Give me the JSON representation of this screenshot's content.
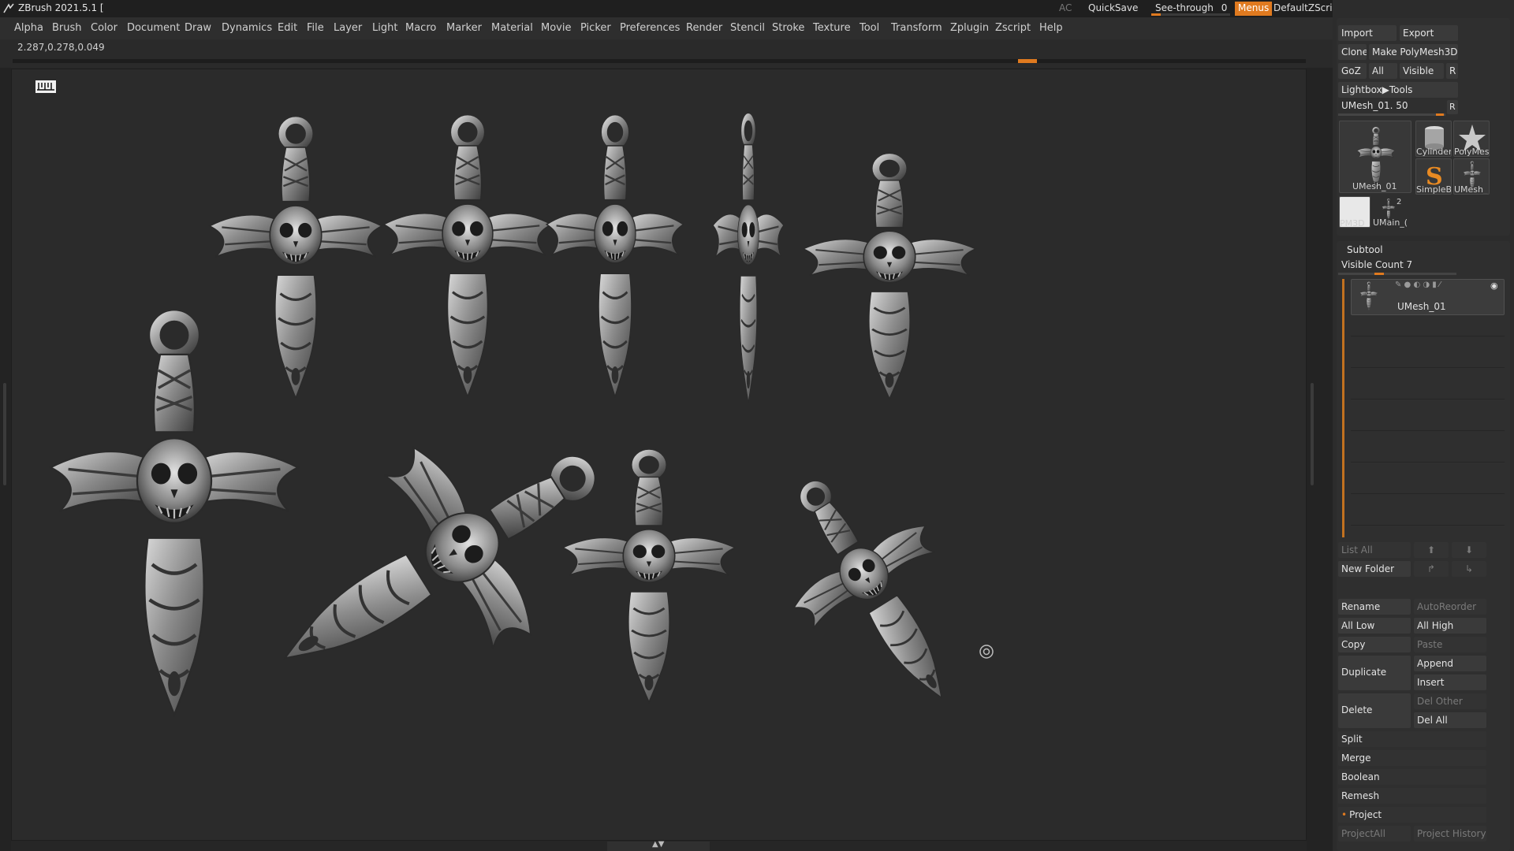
{
  "titlebar": {
    "title": "ZBrush 2021.5.1 [",
    "ac": "AC",
    "quicksave": "QuickSave",
    "see_through_label": "See-through",
    "see_through_value": "0",
    "see_through_fraction": 0.0,
    "menus": "Menus",
    "default_zscript": "DefaultZScript"
  },
  "menubar": {
    "items": [
      "Alpha",
      "Brush",
      "Color",
      "Document",
      "Draw",
      "Dynamics",
      "Edit",
      "File",
      "Layer",
      "Light",
      "Macro",
      "Marker",
      "Material",
      "Movie",
      "Picker",
      "Preferences",
      "Render",
      "Stencil",
      "Stroke",
      "Texture",
      "Tool",
      "Transform",
      "Zplugin",
      "Zscript",
      "Help"
    ]
  },
  "infobar": {
    "coords": "2.287,0.278,0.049"
  },
  "tool": {
    "import": "Import",
    "export": "Export",
    "clone": "Clone",
    "make_polymesh": "Make PolyMesh3D",
    "goz": "GoZ",
    "all": "All",
    "visible": "Visible",
    "r": "R",
    "lightbox_tools": "Lightbox▶Tools",
    "current_tool": "UMesh_01. 50",
    "current_r": "R",
    "thumbs": {
      "main": "UMesh_01",
      "cylinder": "Cylinder",
      "polymesh": "PolyMes",
      "simpleb": "SimpleB",
      "umesh": "UMesh_",
      "pm3d": "PM3D_C",
      "umain": "UMain_(",
      "count": "2"
    }
  },
  "subtool": {
    "title": "Subtool",
    "visible_count": "Visible Count 7",
    "item_name": "UMesh_01",
    "list_all": "List All",
    "new_folder": "New Folder",
    "rename": "Rename",
    "autoreorder": "AutoReorder",
    "all_low": "All Low",
    "all_high": "All High",
    "copy": "Copy",
    "paste": "Paste",
    "duplicate": "Duplicate",
    "append": "Append",
    "insert": "Insert",
    "delete": "Delete",
    "del_other": "Del Other",
    "del_all": "Del All",
    "split": "Split",
    "merge": "Merge",
    "boolean": "Boolean",
    "remesh": "Remesh",
    "project": "Project",
    "project_all": "ProjectAll",
    "project_history": "Project History"
  },
  "colors": {
    "accent": "#e07a1f",
    "background": "#262626",
    "canvas": "#2b2b2b",
    "metal": "#9a9a9a"
  },
  "icons": [
    "zbrush-logo-icon",
    "eye-icon",
    "brush-icon",
    "minimize-icon",
    "restore-icon",
    "close-icon",
    "canvas-center-icon"
  ]
}
